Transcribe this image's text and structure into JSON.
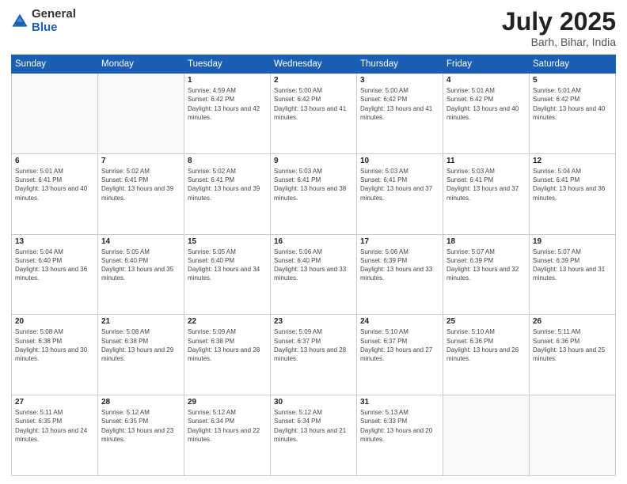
{
  "header": {
    "logo_general": "General",
    "logo_blue": "Blue",
    "month_title": "July 2025",
    "location": "Barh, Bihar, India"
  },
  "days_of_week": [
    "Sunday",
    "Monday",
    "Tuesday",
    "Wednesday",
    "Thursday",
    "Friday",
    "Saturday"
  ],
  "weeks": [
    [
      {
        "day": "",
        "info": ""
      },
      {
        "day": "",
        "info": ""
      },
      {
        "day": "1",
        "info": "Sunrise: 4:59 AM\nSunset: 6:42 PM\nDaylight: 13 hours and 42 minutes."
      },
      {
        "day": "2",
        "info": "Sunrise: 5:00 AM\nSunset: 6:42 PM\nDaylight: 13 hours and 41 minutes."
      },
      {
        "day": "3",
        "info": "Sunrise: 5:00 AM\nSunset: 6:42 PM\nDaylight: 13 hours and 41 minutes."
      },
      {
        "day": "4",
        "info": "Sunrise: 5:01 AM\nSunset: 6:42 PM\nDaylight: 13 hours and 40 minutes."
      },
      {
        "day": "5",
        "info": "Sunrise: 5:01 AM\nSunset: 6:42 PM\nDaylight: 13 hours and 40 minutes."
      }
    ],
    [
      {
        "day": "6",
        "info": "Sunrise: 5:01 AM\nSunset: 6:41 PM\nDaylight: 13 hours and 40 minutes."
      },
      {
        "day": "7",
        "info": "Sunrise: 5:02 AM\nSunset: 6:41 PM\nDaylight: 13 hours and 39 minutes."
      },
      {
        "day": "8",
        "info": "Sunrise: 5:02 AM\nSunset: 6:41 PM\nDaylight: 13 hours and 39 minutes."
      },
      {
        "day": "9",
        "info": "Sunrise: 5:03 AM\nSunset: 6:41 PM\nDaylight: 13 hours and 38 minutes."
      },
      {
        "day": "10",
        "info": "Sunrise: 5:03 AM\nSunset: 6:41 PM\nDaylight: 13 hours and 37 minutes."
      },
      {
        "day": "11",
        "info": "Sunrise: 5:03 AM\nSunset: 6:41 PM\nDaylight: 13 hours and 37 minutes."
      },
      {
        "day": "12",
        "info": "Sunrise: 5:04 AM\nSunset: 6:41 PM\nDaylight: 13 hours and 36 minutes."
      }
    ],
    [
      {
        "day": "13",
        "info": "Sunrise: 5:04 AM\nSunset: 6:40 PM\nDaylight: 13 hours and 36 minutes."
      },
      {
        "day": "14",
        "info": "Sunrise: 5:05 AM\nSunset: 6:40 PM\nDaylight: 13 hours and 35 minutes."
      },
      {
        "day": "15",
        "info": "Sunrise: 5:05 AM\nSunset: 6:40 PM\nDaylight: 13 hours and 34 minutes."
      },
      {
        "day": "16",
        "info": "Sunrise: 5:06 AM\nSunset: 6:40 PM\nDaylight: 13 hours and 33 minutes."
      },
      {
        "day": "17",
        "info": "Sunrise: 5:06 AM\nSunset: 6:39 PM\nDaylight: 13 hours and 33 minutes."
      },
      {
        "day": "18",
        "info": "Sunrise: 5:07 AM\nSunset: 6:39 PM\nDaylight: 13 hours and 32 minutes."
      },
      {
        "day": "19",
        "info": "Sunrise: 5:07 AM\nSunset: 6:39 PM\nDaylight: 13 hours and 31 minutes."
      }
    ],
    [
      {
        "day": "20",
        "info": "Sunrise: 5:08 AM\nSunset: 6:38 PM\nDaylight: 13 hours and 30 minutes."
      },
      {
        "day": "21",
        "info": "Sunrise: 5:08 AM\nSunset: 6:38 PM\nDaylight: 13 hours and 29 minutes."
      },
      {
        "day": "22",
        "info": "Sunrise: 5:09 AM\nSunset: 6:38 PM\nDaylight: 13 hours and 28 minutes."
      },
      {
        "day": "23",
        "info": "Sunrise: 5:09 AM\nSunset: 6:37 PM\nDaylight: 13 hours and 28 minutes."
      },
      {
        "day": "24",
        "info": "Sunrise: 5:10 AM\nSunset: 6:37 PM\nDaylight: 13 hours and 27 minutes."
      },
      {
        "day": "25",
        "info": "Sunrise: 5:10 AM\nSunset: 6:36 PM\nDaylight: 13 hours and 26 minutes."
      },
      {
        "day": "26",
        "info": "Sunrise: 5:11 AM\nSunset: 6:36 PM\nDaylight: 13 hours and 25 minutes."
      }
    ],
    [
      {
        "day": "27",
        "info": "Sunrise: 5:11 AM\nSunset: 6:35 PM\nDaylight: 13 hours and 24 minutes."
      },
      {
        "day": "28",
        "info": "Sunrise: 5:12 AM\nSunset: 6:35 PM\nDaylight: 13 hours and 23 minutes."
      },
      {
        "day": "29",
        "info": "Sunrise: 5:12 AM\nSunset: 6:34 PM\nDaylight: 13 hours and 22 minutes."
      },
      {
        "day": "30",
        "info": "Sunrise: 5:12 AM\nSunset: 6:34 PM\nDaylight: 13 hours and 21 minutes."
      },
      {
        "day": "31",
        "info": "Sunrise: 5:13 AM\nSunset: 6:33 PM\nDaylight: 13 hours and 20 minutes."
      },
      {
        "day": "",
        "info": ""
      },
      {
        "day": "",
        "info": ""
      }
    ]
  ]
}
